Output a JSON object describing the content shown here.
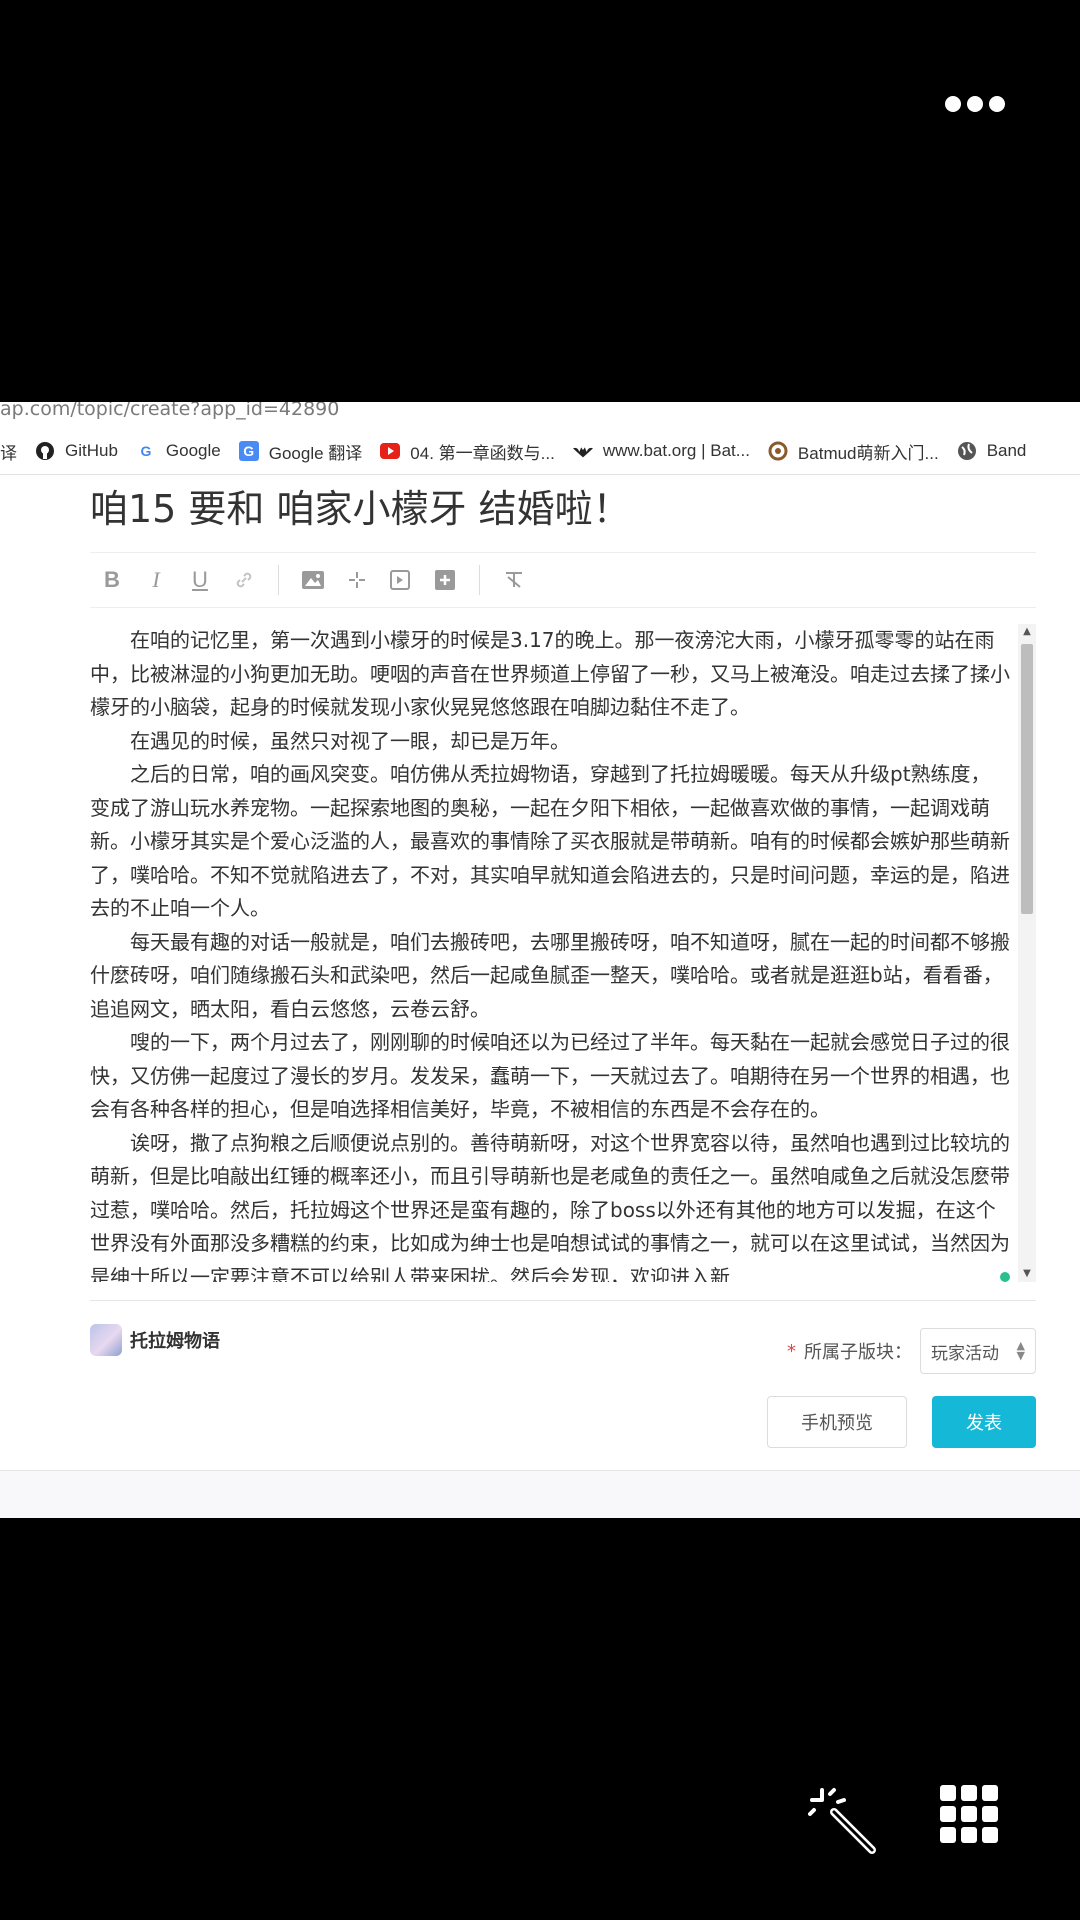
{
  "browser": {
    "url": "ap.com/topic/create?app_id=42890",
    "bookmarks": [
      {
        "icon": "translate-icon",
        "label": "译"
      },
      {
        "icon": "github-icon",
        "label": "GitHub"
      },
      {
        "icon": "google-icon",
        "label": "Google"
      },
      {
        "icon": "google-translate-icon",
        "label": "Google 翻译"
      },
      {
        "icon": "youtube-icon",
        "label": "04. 第一章函数与..."
      },
      {
        "icon": "bat-icon",
        "label": "www.bat.org | Bat..."
      },
      {
        "icon": "batmud-icon",
        "label": "Batmud萌新入门..."
      },
      {
        "icon": "globe-icon",
        "label": "Band"
      }
    ]
  },
  "post": {
    "title": "咱15 要和 咱家小檬牙 结婚啦！",
    "paragraphs": [
      "在咱的记忆里，第一次遇到小檬牙的时候是3.17的晚上。那一夜滂沱大雨，小檬牙孤零零的站在雨中，比被淋湿的小狗更加无助。哽咽的声音在世界频道上停留了一秒，又马上被淹没。咱走过去揉了揉小檬牙的小脑袋，起身的时候就发现小家伙晃晃悠悠跟在咱脚边黏住不走了。",
      "在遇见的时候，虽然只对视了一眼，却已是万年。",
      "之后的日常，咱的画风突变。咱仿佛从秃拉姆物语，穿越到了托拉姆暖暖。每天从升级pt熟练度，变成了游山玩水养宠物。一起探索地图的奥秘，一起在夕阳下相依，一起做喜欢做的事情，一起调戏萌新。小檬牙其实是个爱心泛滥的人，最喜欢的事情除了买衣服就是带萌新。咱有的时候都会嫉妒那些萌新了，噗哈哈。不知不觉就陷进去了，不对，其实咱早就知道会陷进去的，只是时间问题，幸运的是，陷进去的不止咱一个人。",
      "每天最有趣的对话一般就是，咱们去搬砖吧，去哪里搬砖呀，咱不知道呀，腻在一起的时间都不够搬什麽砖呀，咱们随缘搬石头和武染吧，然后一起咸鱼腻歪一整天，噗哈哈。或者就是逛逛b站，看看番，追追网文，晒太阳，看白云悠悠，云卷云舒。",
      "嗖的一下，两个月过去了，刚刚聊的时候咱还以为已经过了半年。每天黏在一起就会感觉日子过的很快，又仿佛一起度过了漫长的岁月。发发呆，蠢萌一下，一天就过去了。咱期待在另一个世界的相遇，也会有各种各样的担心，但是咱选择相信美好，毕竟，不被相信的东西是不会存在的。",
      "诶呀，撒了点狗粮之后顺便说点别的。善待萌新呀，对这个世界宽容以待，虽然咱也遇到过比较坑的萌新，但是比咱敲出红锤的概率还小，而且引导萌新也是老咸鱼的责任之一。虽然咱咸鱼之后就没怎麽带过惹，噗哈哈。然后，托拉姆这个世界还是蛮有趣的，除了boss以外还有其他的地方可以发掘，在这个世界没有外面那没多糟糕的约束，比如成为绅士也是咱想试试的事情之一，就可以在这里试试，当然因为是绅士所以一定要注意不可以给别人带来困扰。然后会发现，欢迎进入新"
    ]
  },
  "game": {
    "name": "托拉姆物语"
  },
  "section": {
    "required_mark": "*",
    "label": "所属子版块：",
    "selected": "玩家活动"
  },
  "buttons": {
    "preview": "手机预览",
    "publish": "发表"
  }
}
